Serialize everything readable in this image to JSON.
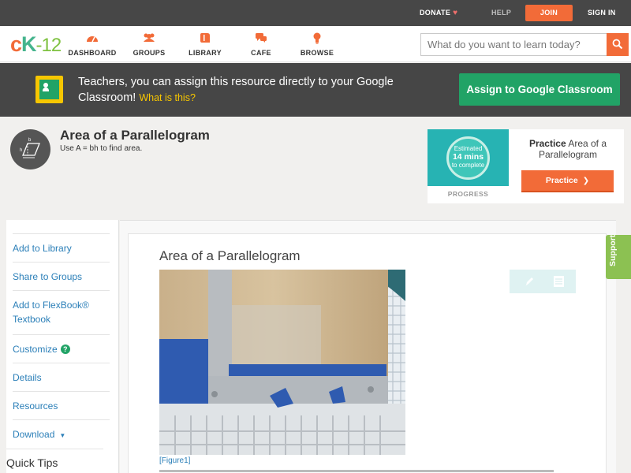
{
  "topbar": {
    "donate": "DONATE",
    "help": "HELP",
    "join": "JOIN",
    "signin": "SIGN IN"
  },
  "logo": {
    "c": "c",
    "k": "K",
    "n": "-12"
  },
  "nav": {
    "items": [
      {
        "label": "DASHBOARD",
        "icon": "speedometer-icon"
      },
      {
        "label": "GROUPS",
        "icon": "people-icon"
      },
      {
        "label": "LIBRARY",
        "icon": "book-icon"
      },
      {
        "label": "CAFE",
        "icon": "chat-bubbles-icon"
      },
      {
        "label": "BROWSE",
        "icon": "lightbulb-icon"
      }
    ],
    "search_placeholder": "What do you want to learn today?"
  },
  "classroom_banner": {
    "text": "Teachers, you can assign this resource directly to your Google Classroom!",
    "what_link": "What is this?",
    "assign_button": "Assign to Google Classroom"
  },
  "concept": {
    "title": "Area of a Parallelogram",
    "subtitle": "Use A = bh to find area."
  },
  "practice_card": {
    "estimated": "Estimated",
    "mins": "14 mins",
    "complete": "to complete",
    "progress_label": "PROGRESS",
    "title_bold": "Practice",
    "title_rest": "Area of a Parallelogram",
    "button": "Practice"
  },
  "sidebar": {
    "items": [
      "Add to Library",
      "Share to Groups",
      "Add to FlexBook® Textbook",
      "Customize",
      "Details",
      "Resources",
      "Download"
    ],
    "quick_tips": "Quick Tips"
  },
  "content": {
    "title": "Area of a Parallelogram",
    "figure_caption": "[Figure1]"
  },
  "support_tab": "Support",
  "colors": {
    "brand_orange": "#f26b38",
    "classroom_green": "#21a366",
    "support_green": "#8cc152",
    "link_blue": "#2b7fb8"
  }
}
